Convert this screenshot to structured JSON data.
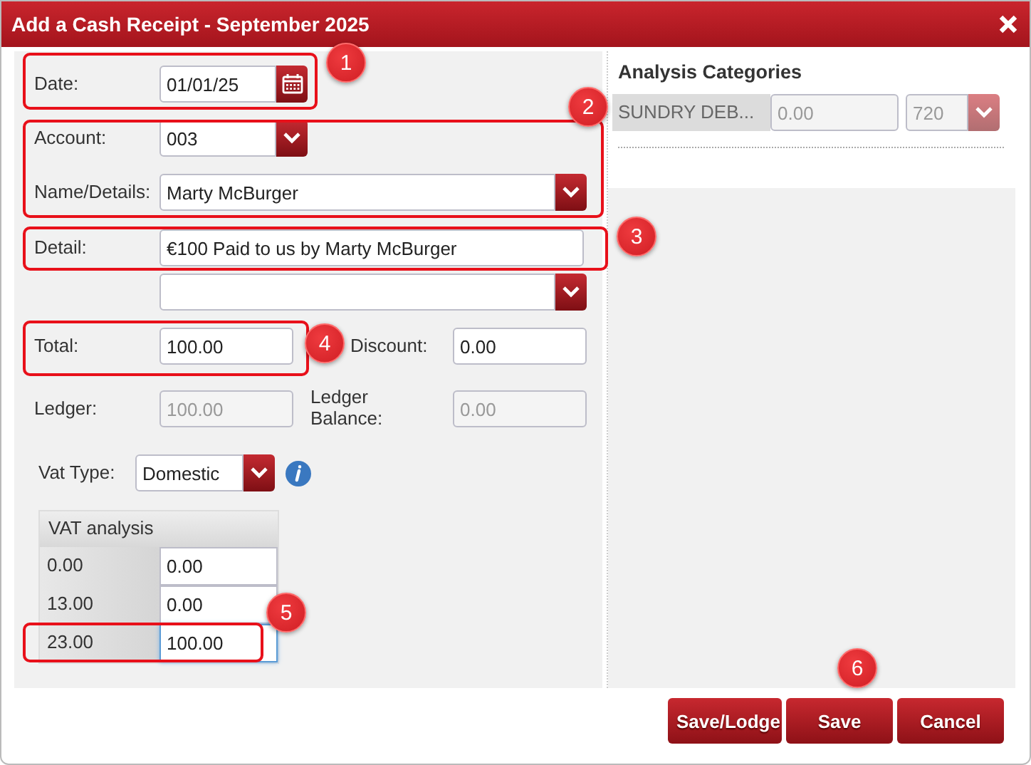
{
  "window": {
    "title": "Add a Cash Receipt - September 2025"
  },
  "form": {
    "date": {
      "label": "Date:",
      "value": "01/01/25"
    },
    "account": {
      "label": "Account:",
      "value": "003"
    },
    "name_details": {
      "label": "Name/Details:",
      "value": "Marty McBurger"
    },
    "detail": {
      "label": "Detail:",
      "value": "€100 Paid to us by Marty McBurger"
    },
    "total": {
      "label": "Total:",
      "value": "100.00",
      "disabled": false
    },
    "discount": {
      "label": "Discount:",
      "value": "0.00",
      "disabled": false
    },
    "ledger": {
      "label": "Ledger:",
      "value": "100.00",
      "disabled": true
    },
    "ledger_balance": {
      "label": "Ledger Balance:",
      "value": "0.00",
      "disabled": true
    },
    "vat_type": {
      "label": "Vat Type:",
      "value": "Domestic"
    }
  },
  "vat_analysis": {
    "title": "VAT analysis",
    "rows": [
      {
        "rate": "0.00",
        "value": "0.00",
        "focused": false
      },
      {
        "rate": "13.00",
        "value": "0.00",
        "focused": false
      },
      {
        "rate": "23.00",
        "value": "100.00",
        "focused": true
      }
    ]
  },
  "analysis_categories": {
    "title": "Analysis Categories",
    "rows": [
      {
        "category": "SUNDRY DEB...",
        "amount": "0.00",
        "code": "720",
        "disabled": true
      }
    ]
  },
  "buttons": [
    {
      "label": "Save/Lodge"
    },
    {
      "label": "Save"
    },
    {
      "label": "Cancel"
    }
  ],
  "annotations": [
    "1",
    "2",
    "3",
    "4",
    "5",
    "6"
  ]
}
